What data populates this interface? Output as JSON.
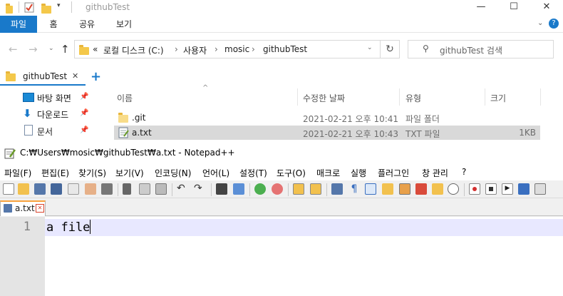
{
  "explorer": {
    "window_title": "githubTest",
    "window_controls": {
      "minimize": "—",
      "maximize": "☐",
      "close": "✕"
    },
    "ribbon_tabs": [
      {
        "label": "파일",
        "active": true
      },
      {
        "label": "홈"
      },
      {
        "label": "공유"
      },
      {
        "label": "보기"
      }
    ],
    "address": {
      "overflow": "«",
      "crumbs": [
        "로컬 디스크 (C:)",
        "사용자",
        "mosic",
        "githubTest"
      ],
      "separator": "›"
    },
    "search_placeholder": "githubTest 검색",
    "tab": {
      "label": "githubTest",
      "add": "+"
    },
    "nav_items": [
      {
        "label": "바탕 화면",
        "icon": "desktop-icon"
      },
      {
        "label": "다운로드",
        "icon": "download-icon"
      },
      {
        "label": "문서",
        "icon": "document-icon"
      }
    ],
    "columns": {
      "name": "이름",
      "date": "수정한 날짜",
      "type": "유형",
      "size": "크기"
    },
    "files": [
      {
        "name": ".git",
        "date": "2021-02-21 오후 10:41",
        "type": "파일 폴더",
        "size": "",
        "icon": "folder-icon",
        "selected": false
      },
      {
        "name": "a.txt",
        "date": "2021-02-21 오후 10:43",
        "type": "TXT 파일",
        "size": "1KB",
        "icon": "text-file-icon",
        "selected": true
      }
    ],
    "accent_color": "#1979ca"
  },
  "notepad": {
    "title": "C:₩Users₩mosic₩githubTest₩a.txt - Notepad++",
    "menu": [
      "파일(F)",
      "편집(E)",
      "찾기(S)",
      "보기(V)",
      "인코딩(N)",
      "언어(L)",
      "설정(T)",
      "도구(O)",
      "매크로",
      "실행",
      "플러그인",
      "창 관리",
      "?"
    ],
    "tab": {
      "label": "a.txt",
      "close": "✕"
    },
    "editor": {
      "line_number": "1",
      "text": "a file"
    },
    "tab_accent": "#f9a23d",
    "current_line_color": "#e8e8ff"
  }
}
